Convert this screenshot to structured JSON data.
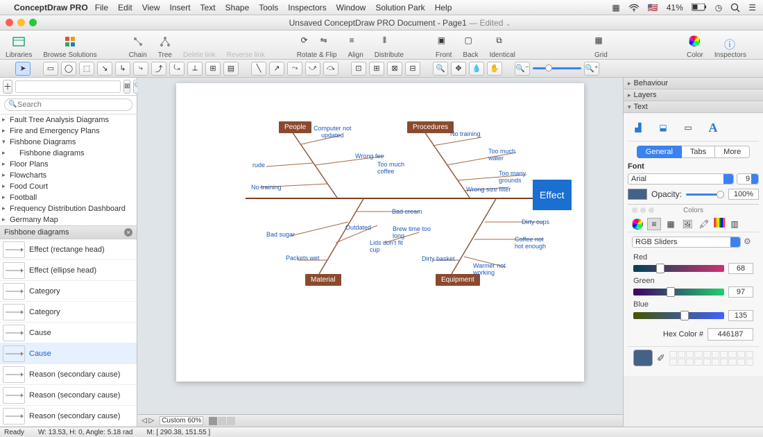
{
  "menubar": {
    "app": "ConceptDraw PRO",
    "items": [
      "File",
      "Edit",
      "View",
      "Insert",
      "Text",
      "Shape",
      "Tools",
      "Inspectors",
      "Window",
      "Solution Park",
      "Help"
    ],
    "battery": "41%"
  },
  "titlebar": {
    "title": "Unsaved ConceptDraw PRO Document - Page1",
    "edited": "— Edited"
  },
  "toolbar": {
    "libraries": "Libraries",
    "browse": "Browse Solutions",
    "chain": "Chain",
    "tree": "Tree",
    "delete_link": "Delete link",
    "reverse_link": "Reverse link",
    "rotate": "Rotate & Flip",
    "align": "Align",
    "distribute": "Distribute",
    "front": "Front",
    "back": "Back",
    "identical": "Identical",
    "grid": "Grid",
    "color": "Color",
    "inspectors": "Inspectors"
  },
  "left": {
    "search_placeholder": "Search",
    "tree": [
      "Fault Tree Analysis Diagrams",
      "Fire and Emergency Plans",
      "Fishbone Diagrams",
      "Floor Plans",
      "Flowcharts",
      "Food Court",
      "Football",
      "Frequency Distribution Dashboard",
      "Germany Map"
    ],
    "tree_child": "Fishbone diagrams",
    "lib_header": "Fishbone diagrams",
    "shapes": [
      "Effect (rectange head)",
      "Effect (ellipse head)",
      "Category",
      "Category",
      "Cause",
      "Cause",
      "Reason (secondary cause)",
      "Reason (secondary cause)",
      "Reason (secondary cause)"
    ],
    "selected_shape_index": 5
  },
  "diagram": {
    "effect": "Effect",
    "categories": {
      "people": "People",
      "procedures": "Procedures",
      "material": "Material",
      "equipment": "Equipment"
    },
    "causes": {
      "computer_not_updated": "Computer not\nupdated",
      "wrong_fee": "Wrong fee",
      "too_much_coffee": "Too much\ncoffee",
      "rude": "rude",
      "no_training_l": "No training",
      "no_training_r": "No training",
      "too_much_water": "Too much\nwater",
      "too_many_grounds": "Too many\ngrounds",
      "wrong_size_filter": "Wrong size filter",
      "bad_cream": "Bad cream",
      "outdated": "Outdated",
      "bad_sugar": "Bad sugar",
      "packets_wet": "Packets wet",
      "lids_dont_fit": "Lids don't fit\ncup",
      "brew_time": "Brew time too\nlong",
      "dirty_basket": "Dirty basket",
      "dirty_cups": "Dirty cups",
      "coffee_not_hot": "Coffee not\nhot enough",
      "warmer_not_working": "Warmer not\nworking"
    }
  },
  "footer": {
    "zoom": "Custom 60%",
    "ready": "Ready",
    "dims": "W: 13.53,  H: 0,  Angle: 5.18 rad",
    "mouse": "M: [ 290.38, 151.55 ]"
  },
  "right": {
    "sections": {
      "behaviour": "Behaviour",
      "layers": "Layers",
      "text": "Text"
    },
    "tabs": {
      "general": "General",
      "tabs": "Tabs",
      "more": "More"
    },
    "font_label": "Font",
    "font_name": "Arial",
    "font_size": "9",
    "opacity_label": "Opacity:",
    "opacity_value": "100%",
    "colors_title": "Colors",
    "rgb_mode": "RGB Sliders",
    "red": {
      "label": "Red",
      "value": "68"
    },
    "green": {
      "label": "Green",
      "value": "97"
    },
    "blue": {
      "label": "Blue",
      "value": "135"
    },
    "hex_label": "Hex Color #",
    "hex_value": "446187"
  }
}
